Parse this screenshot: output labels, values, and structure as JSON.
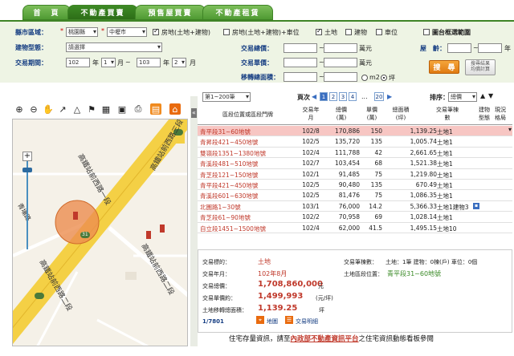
{
  "tabs": [
    "首　頁",
    "不動產買賣",
    "預售屋買賣",
    "不動產租賃"
  ],
  "search": {
    "county_label": "縣市區域：",
    "county_value": "桃園縣",
    "district_value": "中壢市",
    "prop_types": [
      {
        "label": "房地(土地+建物)",
        "checked": true
      },
      {
        "label": "房地(土地+建物)+車位",
        "checked": false
      },
      {
        "label": "土地",
        "checked": true
      },
      {
        "label": "建物",
        "checked": false
      },
      {
        "label": "車位",
        "checked": false
      }
    ],
    "map_range_label": "圖台框選範圍",
    "building_type_label": "建物型態：",
    "building_type_value": "請選擇",
    "total_price_label": "交易總價：",
    "total_price_unit": "萬元",
    "age_label": "屋　齡：",
    "age_unit": "年",
    "period_label": "交易期間：",
    "period_from_year": "102",
    "period_from_month": "1",
    "period_to_year": "103",
    "period_to_month": "2",
    "year_unit": "年",
    "month_unit": "月",
    "month_unit_to": "月",
    "unit_price_label": "交易單價：",
    "unit_price_unit": "萬元",
    "area_label": "移轉總面積：",
    "area_units": [
      "m2",
      "坪"
    ],
    "search_button": "搜　尋",
    "calc_button_1": "搜尋結果",
    "calc_button_2": "均價計算"
  },
  "map": {
    "road_1": "高鐵站前西路一段",
    "road_2": "高鐵站前西路二段",
    "road_3": "高鐵站前西路二段",
    "road_4": "高鐵站前西路三段",
    "road_5": "青埔路",
    "road_badge": "31",
    "zoom_plus": "+",
    "zoom_minus": "−"
  },
  "results": {
    "range_value": "第1~200筆",
    "page_label": "頁次",
    "pages": [
      "1",
      "2",
      "3",
      "4",
      "...",
      "20"
    ],
    "sort_label": "排序：",
    "sort_value": "總價",
    "headers": {
      "location": "區段位置或區段門牌",
      "date": "交易年月",
      "total": "總價(萬)",
      "unit": "單價(萬)",
      "area": "總面積(坪)",
      "trans": "交易筆棟數",
      "btype": "建物型態",
      "site": "現況格局"
    },
    "rows": [
      {
        "loc": "青平段31~60地號",
        "date": "102/8",
        "total": "170,886",
        "unit": "150",
        "area": "1,139.25",
        "trans": "土地1"
      },
      {
        "loc": "青昇段421~450地號",
        "date": "102/5",
        "total": "135,720",
        "unit": "135",
        "area": "1,005.74",
        "trans": "土地1"
      },
      {
        "loc": "雙嶺段1351~1380地號",
        "date": "102/4",
        "total": "111,788",
        "unit": "42",
        "area": "2,661.65",
        "trans": "土地1"
      },
      {
        "loc": "青溪段481~510地號",
        "date": "102/7",
        "total": "103,454",
        "unit": "68",
        "area": "1,521.38",
        "trans": "土地1"
      },
      {
        "loc": "青芝段121~150地號",
        "date": "102/1",
        "total": "91,485",
        "unit": "75",
        "area": "1,219.80",
        "trans": "土地1"
      },
      {
        "loc": "青平段421~450地號",
        "date": "102/5",
        "total": "90,480",
        "unit": "135",
        "area": "670.49",
        "trans": "土地1"
      },
      {
        "loc": "青溪段601~630地號",
        "date": "102/5",
        "total": "81,476",
        "unit": "75",
        "area": "1,086.35",
        "trans": "土地1"
      },
      {
        "loc": "北園路1~30號",
        "date": "103/1",
        "total": "76,000",
        "unit": "14.2",
        "area": "5,366.33",
        "trans": "土地1建物3"
      },
      {
        "loc": "青芝段61~90地號",
        "date": "102/2",
        "total": "70,958",
        "unit": "69",
        "area": "1,028.14",
        "trans": "土地1"
      },
      {
        "loc": "自立段1451~1500地號",
        "date": "102/4",
        "total": "62,000",
        "unit": "41.5",
        "area": "1,495.15",
        "trans": "土地10"
      }
    ]
  },
  "detail": {
    "target_label": "交易標的：",
    "target_value": "土地",
    "date_label": "交易年月：",
    "date_value": "102年8月",
    "total_label": "交易總價：",
    "total_value": "1,708,860,000",
    "total_unit": "元",
    "unit_label": "交易單價約：",
    "unit_value": "1,499,993",
    "unit_unit": "(元/坪)",
    "area_label": "土地移轉總面積：",
    "area_value": "1,139.25",
    "area_unit": "坪",
    "count_label": "交易筆棟數：",
    "count_value": "土地：1筆 建物：0棟(戶) 車位：0個",
    "position_label": "土地區段位置：",
    "position_value": "青平段31~60地號",
    "record_index": "1/7801",
    "map_link": "地圖",
    "detail_link": "交易明細"
  },
  "footer": {
    "prefix": "住宅存量資訊，請至",
    "link": "內政部不動產資訊平台",
    "suffix": "之住宅資訊動態看板參閱"
  },
  "colors": {
    "tab": "#4f9a33",
    "label_blue": "#153d82",
    "highlight_row": "#f7c6c3",
    "value_red": "#c0392b",
    "marker": "#e8803a"
  }
}
